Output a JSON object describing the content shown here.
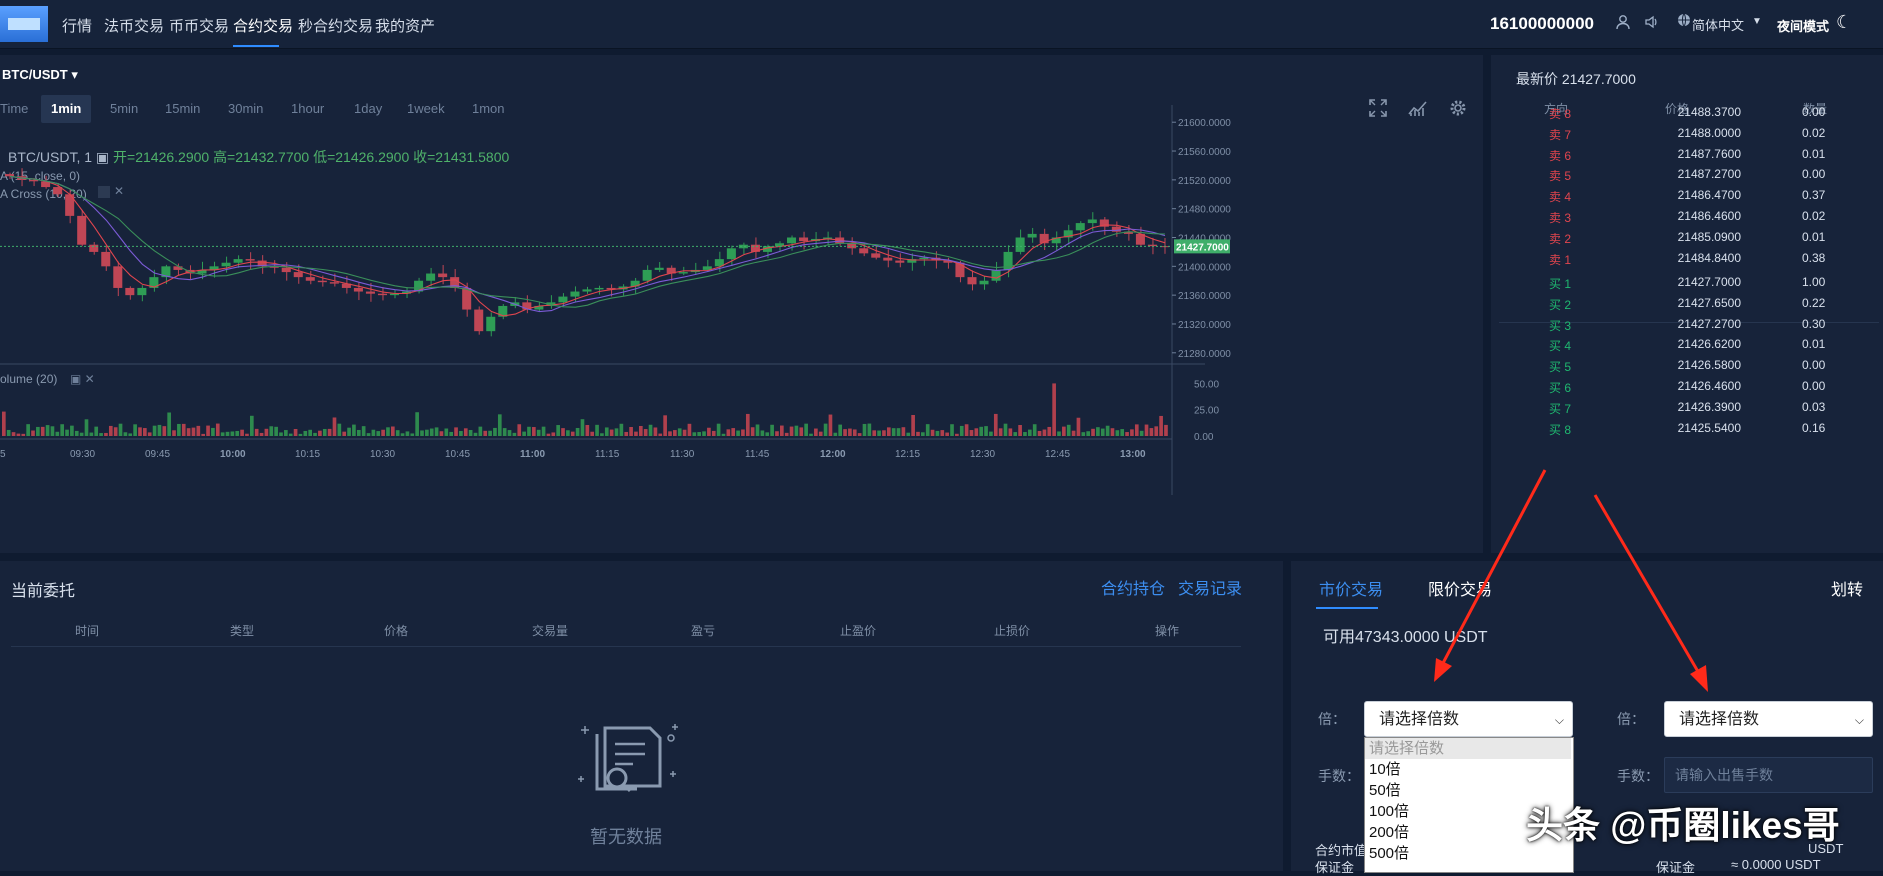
{
  "nav": {
    "items": [
      "行情",
      "法币交易",
      "币币交易",
      "合约交易",
      "秒合约交易",
      "我的资产"
    ],
    "active_index": 3,
    "phone": "16100000000",
    "language": "简体中文",
    "night_mode": "夜间模式"
  },
  "chart": {
    "pair": "BTC/USDT",
    "timeframes": [
      "Time",
      "1min",
      "5min",
      "15min",
      "30min",
      "1hour",
      "1day",
      "1week",
      "1mon"
    ],
    "active_timeframe": "1min",
    "legend_symbol": "BTC/USDT, 1",
    "open": "开=21426.2900",
    "high": "高=21432.7700",
    "low": "低=21426.2900",
    "close": "收=21431.5800",
    "study1": "A (15, close, 0)",
    "study2": "A Cross (10, 20)",
    "volume_label": "olume (20)",
    "last_price_tag": "21427.7000"
  },
  "chart_data": {
    "type": "candlestick",
    "title": "BTC/USDT, 1",
    "price_axis": [
      "21600.0000",
      "21560.0000",
      "21520.0000",
      "21480.0000",
      "21440.0000",
      "21400.0000",
      "21360.0000",
      "21320.0000",
      "21280.0000"
    ],
    "ylim": [
      21270,
      21610
    ],
    "volume_axis": [
      "50.00",
      "25.00",
      "0.00"
    ],
    "volume_ylim": [
      0,
      58
    ],
    "time_axis": [
      "5",
      "09:30",
      "09:45",
      "10:00",
      "10:15",
      "10:30",
      "10:45",
      "11:00",
      "11:15",
      "11:30",
      "11:45",
      "12:00",
      "12:15",
      "12:30",
      "12:45",
      "13:00"
    ],
    "close_path": [
      21525,
      21520,
      21518,
      21510,
      21500,
      21470,
      21430,
      21420,
      21400,
      21370,
      21360,
      21370,
      21385,
      21400,
      21395,
      21390,
      21395,
      21400,
      21405,
      21410,
      21408,
      21400,
      21398,
      21392,
      21385,
      21380,
      21378,
      21376,
      21370,
      21365,
      21362,
      21360,
      21362,
      21365,
      21380,
      21390,
      21385,
      21370,
      21340,
      21310,
      21330,
      21345,
      21350,
      21340,
      21345,
      21350,
      21358,
      21365,
      21368,
      21370,
      21368,
      21372,
      21380,
      21395,
      21398,
      21390,
      21392,
      21395,
      21400,
      21410,
      21425,
      21430,
      21420,
      21428,
      21432,
      21440,
      21435,
      21438,
      21440,
      21432,
      21425,
      21418,
      21412,
      21408,
      21405,
      21410,
      21412,
      21408,
      21405,
      21385,
      21375,
      21380,
      21395,
      21420,
      21440,
      21445,
      21432,
      21440,
      21450,
      21460,
      21465,
      21455,
      21448,
      21445,
      21430,
      21428,
      21427.7
    ]
  },
  "book": {
    "latest": "最新价 21427.7000",
    "headers": [
      "方向",
      "价格",
      "数量"
    ],
    "sells": [
      {
        "side": "卖 8",
        "price": "21488.3700",
        "qty": "0.00"
      },
      {
        "side": "卖 7",
        "price": "21488.0000",
        "qty": "0.02"
      },
      {
        "side": "卖 6",
        "price": "21487.7600",
        "qty": "0.01"
      },
      {
        "side": "卖 5",
        "price": "21487.2700",
        "qty": "0.00"
      },
      {
        "side": "卖 4",
        "price": "21486.4700",
        "qty": "0.37"
      },
      {
        "side": "卖 3",
        "price": "21486.4600",
        "qty": "0.02"
      },
      {
        "side": "卖 2",
        "price": "21485.0900",
        "qty": "0.01"
      },
      {
        "side": "卖 1",
        "price": "21484.8400",
        "qty": "0.38"
      }
    ],
    "buys": [
      {
        "side": "买 1",
        "price": "21427.7000",
        "qty": "1.00"
      },
      {
        "side": "买 2",
        "price": "21427.6500",
        "qty": "0.22"
      },
      {
        "side": "买 3",
        "price": "21427.2700",
        "qty": "0.30"
      },
      {
        "side": "买 4",
        "price": "21426.6200",
        "qty": "0.01"
      },
      {
        "side": "买 5",
        "price": "21426.5800",
        "qty": "0.00"
      },
      {
        "side": "买 6",
        "price": "21426.4600",
        "qty": "0.00"
      },
      {
        "side": "买 7",
        "price": "21426.3900",
        "qty": "0.03"
      },
      {
        "side": "买 8",
        "price": "21425.5400",
        "qty": "0.16"
      }
    ],
    "sell_color": "#e0454e",
    "buy_color": "#1fb870"
  },
  "orders": {
    "title": "当前委托",
    "link_positions": "合约持仓",
    "link_history": "交易记录",
    "columns": [
      "时间",
      "类型",
      "价格",
      "交易量",
      "盈亏",
      "止盈价",
      "止损价",
      "操作"
    ],
    "empty": "暂无数据"
  },
  "trade": {
    "tab_market": "市价交易",
    "tab_limit": "限价交易",
    "transfer": "划转",
    "available": "可用47343.0000 USDT",
    "leverage_label": "倍：",
    "qty_label": "手数：",
    "select_placeholder": "请选择倍数",
    "sell_qty_placeholder": "请输入出售手数",
    "options": [
      "请选择倍数",
      "10倍",
      "50倍",
      "100倍",
      "200倍",
      "500倍"
    ],
    "contract_value_label": "合约市值",
    "margin_label": "保证金",
    "margin_right_label": "保证金",
    "right_value1": "USDT",
    "right_value2": "≈ 0.0000 USDT"
  },
  "watermark": "头条 @币圈likes哥"
}
